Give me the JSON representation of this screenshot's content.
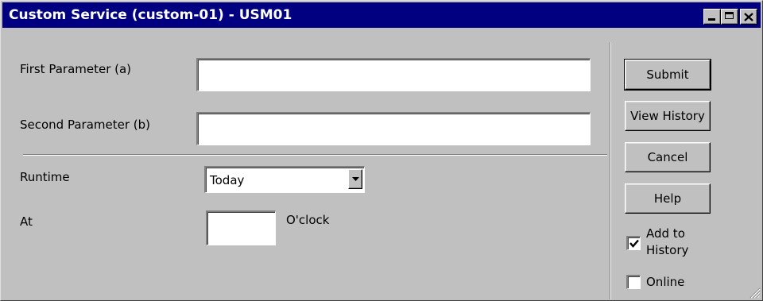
{
  "window": {
    "title": "Custom Service (custom-01) - USM01",
    "controls": {
      "minimize_icon": "minimize-icon",
      "maximize_icon": "maximize-icon",
      "close_icon": "close-icon"
    }
  },
  "form": {
    "first_parameter": {
      "label": "First Parameter (a)",
      "value": ""
    },
    "second_parameter": {
      "label": "Second Parameter (b)",
      "value": ""
    },
    "runtime": {
      "label": "Runtime",
      "selected": "Today"
    },
    "at": {
      "label": "At",
      "value": "",
      "suffix": "O'clock"
    }
  },
  "actions": {
    "submit_label": "Submit",
    "view_history_label": "View History",
    "cancel_label": "Cancel",
    "help_label": "Help"
  },
  "options": {
    "add_to_history": {
      "label_line1": "Add to",
      "label_line2": "History",
      "checked": true
    },
    "online": {
      "label": "Online",
      "checked": false
    }
  },
  "colors": {
    "titlebar": "#000080",
    "face": "#c0c0c0",
    "field": "#ffffff"
  }
}
